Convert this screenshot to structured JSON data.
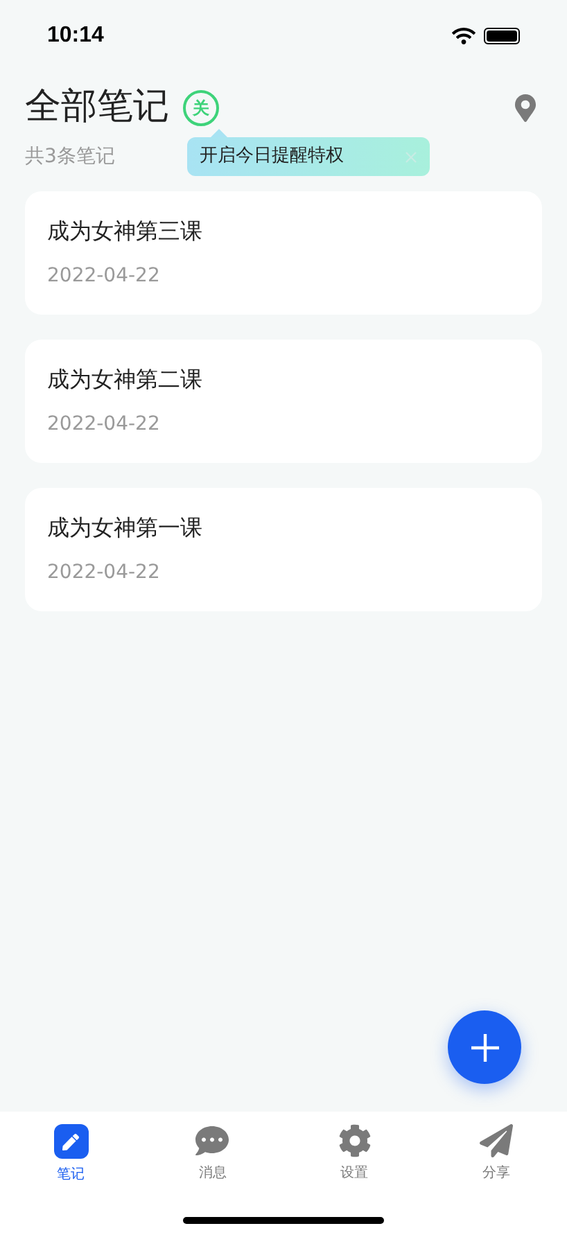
{
  "status_bar": {
    "time": "10:14"
  },
  "header": {
    "title": "全部笔记",
    "badge": "关",
    "count": "共3条笔记"
  },
  "tooltip": {
    "text": "开启今日提醒特权"
  },
  "notes": [
    {
      "title": "成为女神第三课",
      "date": "2022-04-22"
    },
    {
      "title": "成为女神第二课",
      "date": "2022-04-22"
    },
    {
      "title": "成为女神第一课",
      "date": "2022-04-22"
    }
  ],
  "tabs": [
    {
      "kind": "notes",
      "label": "笔记",
      "selected": true
    },
    {
      "kind": "messages",
      "label": "消息",
      "selected": false
    },
    {
      "kind": "settings",
      "label": "设置",
      "selected": false
    },
    {
      "kind": "share",
      "label": "分享",
      "selected": false
    }
  ]
}
